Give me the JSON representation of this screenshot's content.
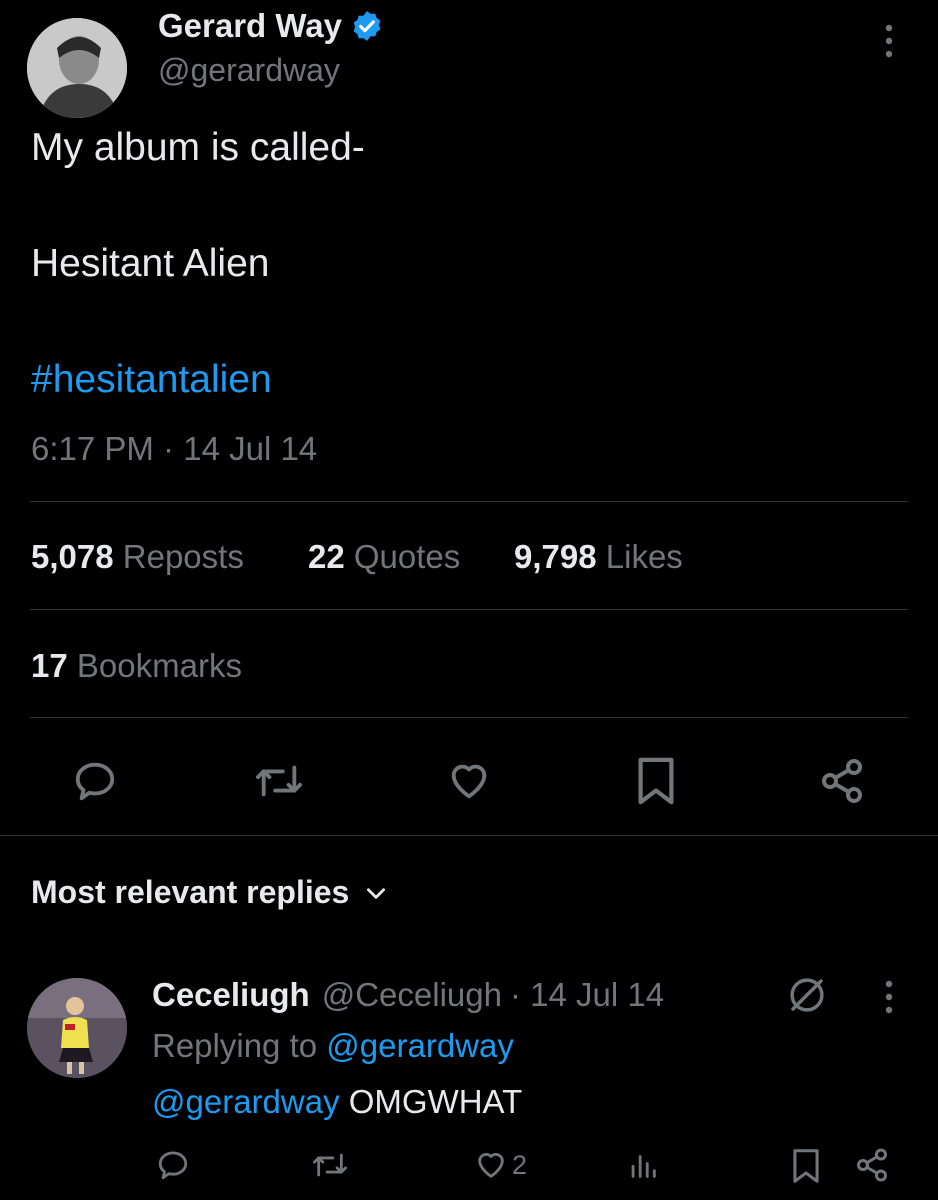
{
  "tweet": {
    "author_name": "Gerard Way",
    "author_handle": "@gerardway",
    "text_line1": "My album is called-",
    "text_line2": "Hesitant Alien",
    "hashtag": "#hesitantalien",
    "timestamp": "6:17 PM · 14 Jul 14",
    "stats": {
      "reposts_count": "5,078",
      "reposts_label": "Reposts",
      "quotes_count": "22",
      "quotes_label": "Quotes",
      "likes_count": "9,798",
      "likes_label": "Likes",
      "bookmarks_count": "17",
      "bookmarks_label": "Bookmarks"
    },
    "actions": [
      "reply-icon",
      "repost-icon",
      "like-icon",
      "bookmark-icon",
      "share-icon"
    ]
  },
  "replies_header": {
    "label": "Most relevant replies"
  },
  "reply": {
    "author_name": "Ceceliugh",
    "author_handle": "@Ceceliugh",
    "date": "· 14 Jul 14",
    "replying_to_label": "Replying to",
    "replying_to_handle": "@gerardway",
    "mention": "@gerardway",
    "text": "OMGWHAT",
    "like_count": "2"
  },
  "colors": {
    "background": "#000000",
    "text": "#e7e9ea",
    "muted": "#71767b",
    "accent": "#1d9bf0",
    "divider": "#2f3336"
  }
}
